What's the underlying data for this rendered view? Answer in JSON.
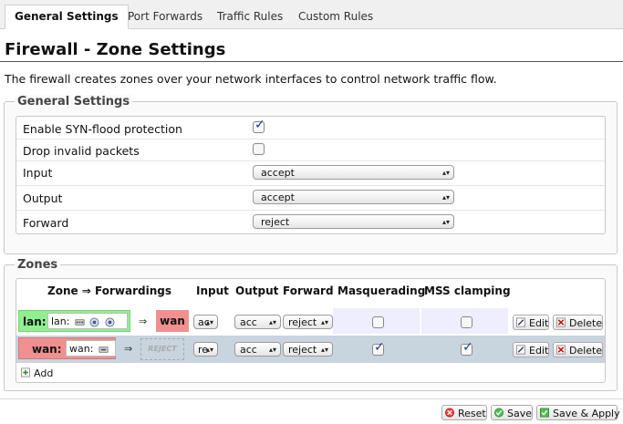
{
  "tabs": [
    {
      "label": "General Settings"
    },
    {
      "label": "Port Forwards"
    },
    {
      "label": "Traffic Rules"
    },
    {
      "label": "Custom Rules"
    }
  ],
  "page": {
    "title": "Firewall - Zone Settings",
    "description": "The firewall creates zones over your network interfaces to control network traffic flow."
  },
  "general": {
    "legend": "General Settings",
    "syn_label": "Enable SYN-flood protection",
    "syn_checked": true,
    "drop_label": "Drop invalid packets",
    "drop_checked": false,
    "input_label": "Input",
    "input_value": "accept",
    "output_label": "Output",
    "output_value": "accept",
    "forward_label": "Forward",
    "forward_value": "reject"
  },
  "zones": {
    "legend": "Zones",
    "headers": {
      "zone": "Zone ⇒ Forwardings",
      "input": "Input",
      "output": "Output",
      "forward": "Forward",
      "masq": "Masquerading",
      "mss": "MSS clamping"
    },
    "arrow": "⇒",
    "edit_label": "Edit",
    "delete_label": "Delete",
    "add_label": "Add",
    "rows": [
      {
        "name": "lan:",
        "inner": "lan:",
        "target": "wan",
        "input": "ac",
        "output": "acc",
        "forward": "reject",
        "masq": false,
        "mss": false
      },
      {
        "name": "wan:",
        "inner": "wan:",
        "target": "REJECT",
        "input": "re",
        "output": "acc",
        "forward": "reject",
        "masq": true,
        "mss": true
      }
    ]
  },
  "footer": {
    "reset_label": "Reset",
    "save_label": "Save",
    "apply_label": "Save & Apply"
  },
  "colors": {
    "lan_zone": "#90f090",
    "wan_zone": "#f09090",
    "row_alt": "#eeeeff",
    "row_alt2": "#c8d4de"
  }
}
